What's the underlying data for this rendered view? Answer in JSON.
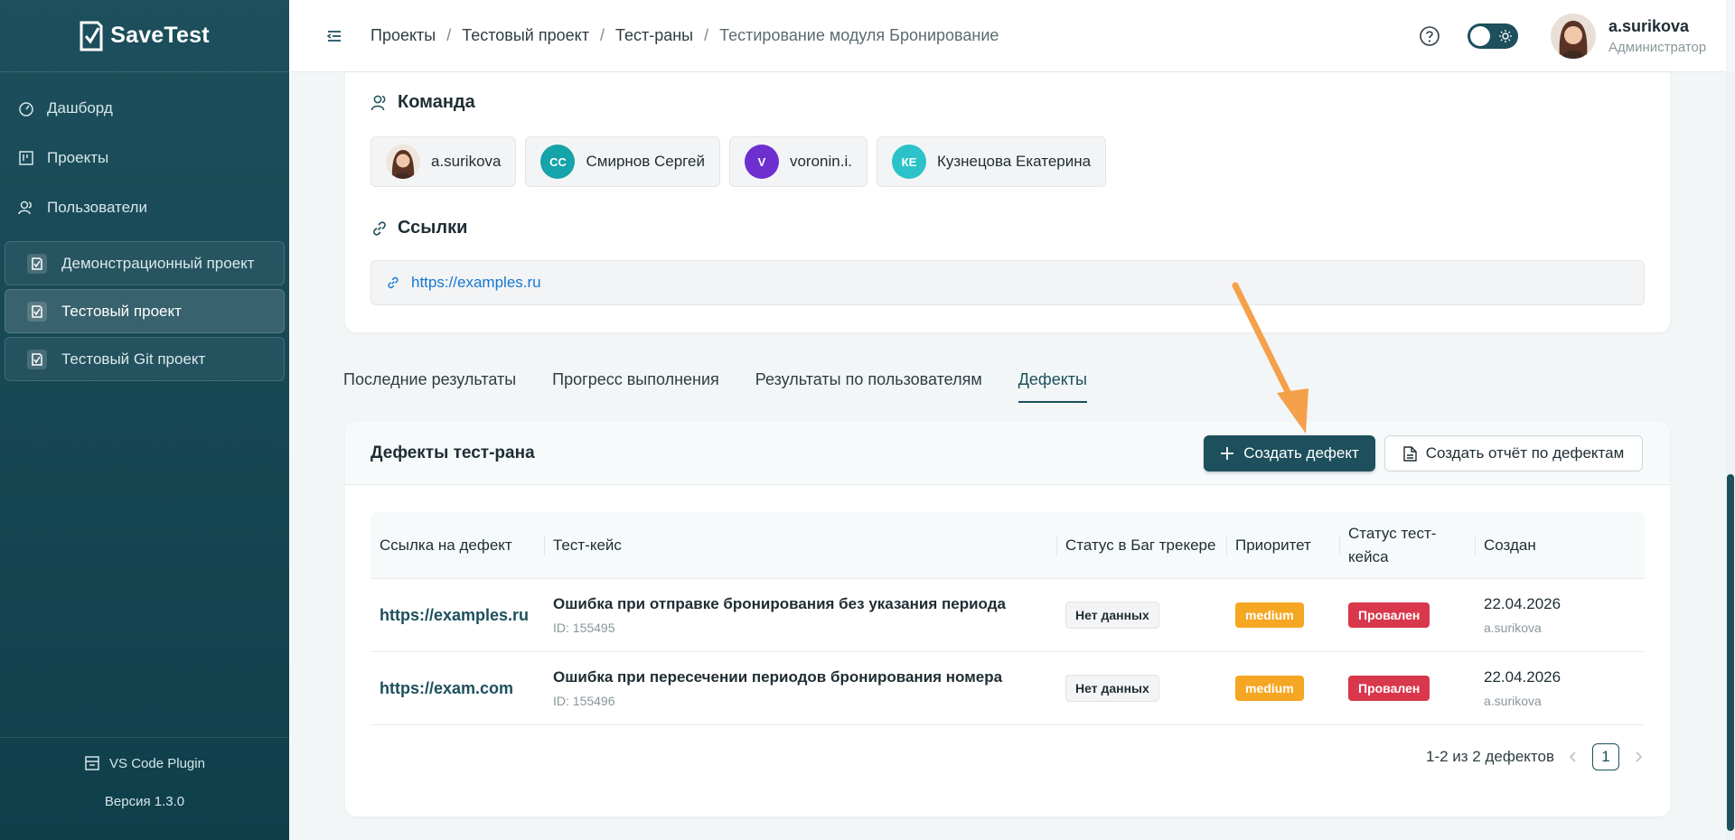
{
  "app": {
    "name": "SaveTest",
    "version": "Версия 1.3.0",
    "plugin": "VS Code Plugin"
  },
  "colors": {
    "primary": "#1d4f5c",
    "link": "#1677d2",
    "warning": "#f5a623",
    "danger": "#d9374b",
    "arrow": "#f5a04a"
  },
  "sidebar": {
    "nav": [
      {
        "label": "Дашборд",
        "icon": "dashboard-icon"
      },
      {
        "label": "Проекты",
        "icon": "board-icon"
      },
      {
        "label": "Пользователи",
        "icon": "users-icon"
      }
    ],
    "projects": [
      {
        "label": "Демонстрационный проект",
        "active": false
      },
      {
        "label": "Тестовый проект",
        "active": true
      },
      {
        "label": "Тестовый Git проект",
        "active": false
      }
    ]
  },
  "header": {
    "breadcrumbs": [
      "Проекты",
      "Тестовый проект",
      "Тест-раны",
      "Тестирование модуля Бронирование"
    ],
    "user": {
      "name": "a.surikova",
      "role": "Администратор"
    }
  },
  "team": {
    "title": "Команда",
    "members": [
      {
        "name": "a.surikova",
        "initials": "",
        "color": "#7a4a3a"
      },
      {
        "name": "Смирнов Сергей",
        "initials": "СС",
        "color": "#16a3a9"
      },
      {
        "name": "voronin.i.",
        "initials": "V",
        "color": "#6d2fcf"
      },
      {
        "name": "Кузнецова Екатерина",
        "initials": "КЕ",
        "color": "#2bc3c9"
      }
    ]
  },
  "links": {
    "title": "Ссылки",
    "items": [
      "https://examples.ru"
    ]
  },
  "tabs": [
    "Последние результаты",
    "Прогресс выполнения",
    "Результаты по пользователям",
    "Дефекты"
  ],
  "defects": {
    "title": "Дефекты тест-рана",
    "create_button": "Создать дефект",
    "report_button": "Создать отчёт по дефектам",
    "columns": [
      "Ссылка на дефект",
      "Тест-кейс",
      "Статус в Баг трекере",
      "Приоритет",
      "Статус тест-кейса",
      "Создан"
    ],
    "rows": [
      {
        "link": "https://examples.ru",
        "case": "Ошибка при отправке бронирования без указания периода",
        "case_id": "ID: 155495",
        "tracker_status": "Нет данных",
        "priority": "medium",
        "case_status": "Провален",
        "date": "22.04.2026",
        "author": "a.surikova"
      },
      {
        "link": "https://exam.com",
        "case": "Ошибка при пересечении периодов бронирования номера",
        "case_id": "ID: 155496",
        "tracker_status": "Нет данных",
        "priority": "medium",
        "case_status": "Провален",
        "date": "22.04.2026",
        "author": "a.surikova"
      }
    ],
    "pagination": {
      "summary": "1-2 из 2 дефектов",
      "current_page": "1"
    }
  }
}
